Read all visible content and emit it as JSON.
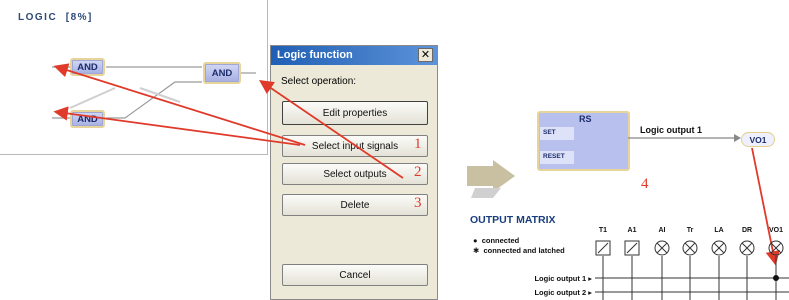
{
  "logic_panel": {
    "title": "LOGIC",
    "percent": "[8%]",
    "gates": [
      "AND",
      "AND",
      "AND"
    ]
  },
  "dialog": {
    "title": "Logic function",
    "close_glyph": "✕",
    "prompt": "Select operation:",
    "buttons": {
      "edit": "Edit properties",
      "inputs": "Select input signals",
      "outputs": "Select outputs",
      "delete": "Delete",
      "cancel": "Cancel"
    },
    "step_numbers": [
      "1",
      "2",
      "3"
    ]
  },
  "rs_block": {
    "title": "RS",
    "set_label": "SET",
    "reset_label": "RESET",
    "output_label": "Logic output 1",
    "vo_tag": "VO1",
    "step_number": "4"
  },
  "output_matrix": {
    "title": "OUTPUT MATRIX",
    "legend": [
      {
        "symbol": "●",
        "text": "connected"
      },
      {
        "symbol": "✱",
        "text": "connected and latched"
      }
    ],
    "columns": [
      "T1",
      "A1",
      "AI",
      "Tr",
      "LA",
      "DR",
      "VO1"
    ],
    "column_symbols": [
      "box-slash",
      "box-slash",
      "circle-x",
      "circle-x",
      "circle-x",
      "circle-x",
      "circle-x"
    ],
    "rows": [
      "Logic output 1",
      "Logic output 2"
    ],
    "connected_cell": {
      "row": "Logic output 1",
      "column": "VO1"
    }
  },
  "colors": {
    "annotation_red": "#e03a2a",
    "gate_fill": "#b8c1ee",
    "gate_border": "#e6d49a",
    "title_blue": "#1a3e7c",
    "dialog_title_bar": "#1f5fb4"
  }
}
